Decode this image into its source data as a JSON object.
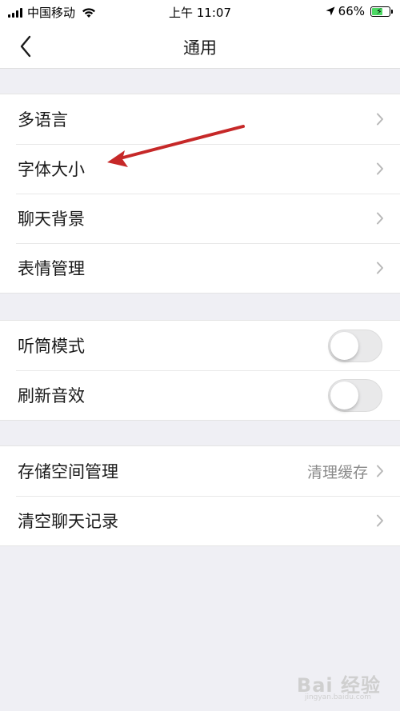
{
  "status_bar": {
    "carrier": "中国移动",
    "time": "上午 11:07",
    "battery_percent": "66%",
    "battery_level": 0.66,
    "icons": [
      "signal-icon",
      "wifi-icon",
      "location-arrow-icon",
      "battery-charging-icon"
    ]
  },
  "nav": {
    "back_icon": "chevron-left-icon",
    "title": "通用"
  },
  "group1": {
    "items": [
      {
        "label": "多语言",
        "icon": "chevron-right-icon"
      },
      {
        "label": "字体大小",
        "icon": "chevron-right-icon"
      },
      {
        "label": "聊天背景",
        "icon": "chevron-right-icon"
      },
      {
        "label": "表情管理",
        "icon": "chevron-right-icon"
      }
    ]
  },
  "group2": {
    "items": [
      {
        "label": "听筒模式",
        "toggle_on": false
      },
      {
        "label": "刷新音效",
        "toggle_on": false
      }
    ]
  },
  "group3": {
    "items": [
      {
        "label": "存储空间管理",
        "value": "清理缓存",
        "icon": "chevron-right-icon"
      },
      {
        "label": "清空聊天记录",
        "icon": "chevron-right-icon"
      }
    ]
  },
  "annotation": {
    "type": "red-arrow",
    "color": "#c62828",
    "points_to": "字体大小"
  },
  "watermark": {
    "text": "Bai 经验",
    "subtext": "jingyan.baidu.com"
  },
  "colors": {
    "background": "#efeff4",
    "card": "#ffffff",
    "secondary_text": "#8a8a8a",
    "toggle_off": "#e9e9ea"
  }
}
